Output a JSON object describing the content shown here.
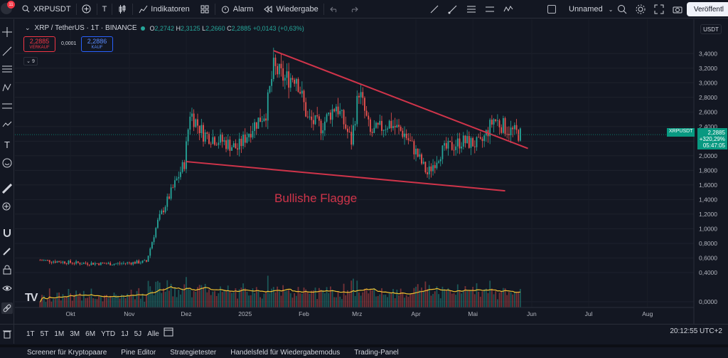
{
  "topbar": {
    "avatar_badge": "11",
    "symbol": "XRPUSDT",
    "text_tool": "T",
    "indicators": "Indikatoren",
    "alarm": "Alarm",
    "replay": "Wiedergabe",
    "layout_name": "Unnamed",
    "publish": "Veröffentl"
  },
  "legend": {
    "title": "XRP / TetherUS · 1T · BINANCE",
    "open_label": "O",
    "open": "2,2742",
    "high_label": "H",
    "high": "2,3125",
    "low_label": "L",
    "low": "2,2660",
    "close_label": "C",
    "close": "2,2885",
    "change": "+0,0143 (+0,63%)"
  },
  "trade": {
    "sell_price": "2,2885",
    "sell_label": "VERKAUF",
    "spread": "0,0001",
    "buy_price": "2,2886",
    "buy_label": "KAUF"
  },
  "indicator_count": "9",
  "currency": "USDT",
  "price_tag": {
    "symbol": "XRPUSDT",
    "price": "2,2885",
    "change_pct": "+320,29%",
    "countdown": "05:47:05"
  },
  "colors": {
    "up": "#26a69a",
    "down": "#ef5350",
    "annotation": "#d0344a",
    "volume_ma": "#f0c030",
    "background": "#131722"
  },
  "chart_data": {
    "type": "candlestick",
    "title": "XRP / TetherUS · 1T · BINANCE",
    "y_ticks": [
      "3,4000",
      "3,2000",
      "3,0000",
      "2,8000",
      "2,6000",
      "2,4000",
      "2,2000",
      "2,0000",
      "1,8000",
      "1,6000",
      "1,4000",
      "1,2000",
      "1,0000",
      "0,8000",
      "0,6000",
      "0,4000",
      "0,0000"
    ],
    "x_ticks": [
      "Okt",
      "Nov",
      "Dez",
      "2025",
      "Feb",
      "Mrz",
      "Apr",
      "Mai",
      "Jun",
      "Jul",
      "Aug"
    ],
    "annotation_text": "Bullishe Flagge",
    "ylim": [
      0.0,
      3.5
    ],
    "pattern_lines": {
      "upper": [
        {
          "date": "2025-01-16",
          "price": 3.44
        },
        {
          "date": "2025-05-30",
          "price": 2.1
        }
      ],
      "lower": [
        {
          "date": "2024-12-01",
          "price": 1.92
        },
        {
          "date": "2025-05-18",
          "price": 1.52
        }
      ]
    },
    "price_path": [
      {
        "date": "2024-09-15",
        "price": 0.57
      },
      {
        "date": "2024-10-05",
        "price": 0.53
      },
      {
        "date": "2024-10-25",
        "price": 0.52
      },
      {
        "date": "2024-11-10",
        "price": 0.55
      },
      {
        "date": "2024-11-16",
        "price": 1.1
      },
      {
        "date": "2024-11-23",
        "price": 1.5
      },
      {
        "date": "2024-11-30",
        "price": 1.9
      },
      {
        "date": "2024-12-03",
        "price": 2.6
      },
      {
        "date": "2024-12-10",
        "price": 2.3
      },
      {
        "date": "2024-12-20",
        "price": 2.2
      },
      {
        "date": "2024-12-28",
        "price": 2.1
      },
      {
        "date": "2025-01-05",
        "price": 2.4
      },
      {
        "date": "2025-01-12",
        "price": 2.6
      },
      {
        "date": "2025-01-16",
        "price": 3.2
      },
      {
        "date": "2025-01-22",
        "price": 3.05
      },
      {
        "date": "2025-01-28",
        "price": 3.1
      },
      {
        "date": "2025-02-03",
        "price": 2.5
      },
      {
        "date": "2025-02-10",
        "price": 2.4
      },
      {
        "date": "2025-02-18",
        "price": 2.7
      },
      {
        "date": "2025-02-26",
        "price": 2.2
      },
      {
        "date": "2025-03-02",
        "price": 2.9
      },
      {
        "date": "2025-03-08",
        "price": 2.3
      },
      {
        "date": "2025-03-18",
        "price": 2.45
      },
      {
        "date": "2025-03-26",
        "price": 2.3
      },
      {
        "date": "2025-04-01",
        "price": 2.05
      },
      {
        "date": "2025-04-07",
        "price": 1.75
      },
      {
        "date": "2025-04-14",
        "price": 2.05
      },
      {
        "date": "2025-04-25",
        "price": 2.2
      },
      {
        "date": "2025-05-05",
        "price": 2.15
      },
      {
        "date": "2025-05-12",
        "price": 2.5
      },
      {
        "date": "2025-05-20",
        "price": 2.35
      },
      {
        "date": "2025-05-26",
        "price": 2.29
      }
    ]
  },
  "range_buttons": [
    "1T",
    "5T",
    "1M",
    "3M",
    "6M",
    "YTD",
    "1J",
    "5J",
    "Alle"
  ],
  "timestamp": "20:12:55 UTC+2",
  "bottom_tabs": [
    "Screener für Kryptopaare",
    "Pine Editor",
    "Strategietester",
    "Handelsfeld für Wiedergabemodus",
    "Trading-Panel"
  ]
}
